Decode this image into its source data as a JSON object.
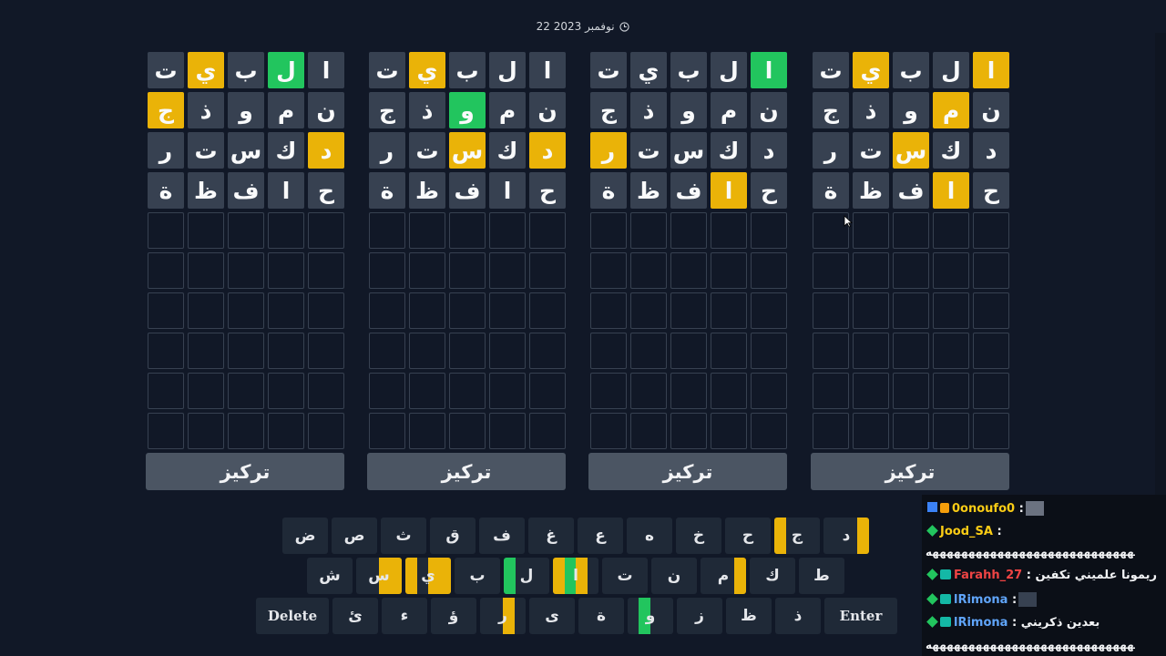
{
  "date": "22 نوفمبر 2023",
  "focus_label": "تركيز",
  "boards": [
    {
      "rows": [
        [
          {
            "c": "ا",
            "s": ""
          },
          {
            "c": "ل",
            "s": "g"
          },
          {
            "c": "ب",
            "s": ""
          },
          {
            "c": "ي",
            "s": "y"
          },
          {
            "c": "ت",
            "s": ""
          }
        ],
        [
          {
            "c": "ن",
            "s": ""
          },
          {
            "c": "م",
            "s": ""
          },
          {
            "c": "و",
            "s": ""
          },
          {
            "c": "ذ",
            "s": ""
          },
          {
            "c": "ج",
            "s": "y"
          }
        ],
        [
          {
            "c": "د",
            "s": "y"
          },
          {
            "c": "ك",
            "s": ""
          },
          {
            "c": "س",
            "s": ""
          },
          {
            "c": "ت",
            "s": ""
          },
          {
            "c": "ر",
            "s": ""
          }
        ],
        [
          {
            "c": "ح",
            "s": ""
          },
          {
            "c": "ا",
            "s": ""
          },
          {
            "c": "ف",
            "s": ""
          },
          {
            "c": "ظ",
            "s": ""
          },
          {
            "c": "ة",
            "s": ""
          }
        ]
      ]
    },
    {
      "rows": [
        [
          {
            "c": "ا",
            "s": ""
          },
          {
            "c": "ل",
            "s": ""
          },
          {
            "c": "ب",
            "s": ""
          },
          {
            "c": "ي",
            "s": "y"
          },
          {
            "c": "ت",
            "s": ""
          }
        ],
        [
          {
            "c": "ن",
            "s": ""
          },
          {
            "c": "م",
            "s": ""
          },
          {
            "c": "و",
            "s": "g"
          },
          {
            "c": "ذ",
            "s": ""
          },
          {
            "c": "ج",
            "s": ""
          }
        ],
        [
          {
            "c": "د",
            "s": "y"
          },
          {
            "c": "ك",
            "s": ""
          },
          {
            "c": "س",
            "s": "y"
          },
          {
            "c": "ت",
            "s": ""
          },
          {
            "c": "ر",
            "s": ""
          }
        ],
        [
          {
            "c": "ح",
            "s": ""
          },
          {
            "c": "ا",
            "s": ""
          },
          {
            "c": "ف",
            "s": ""
          },
          {
            "c": "ظ",
            "s": ""
          },
          {
            "c": "ة",
            "s": ""
          }
        ]
      ]
    },
    {
      "rows": [
        [
          {
            "c": "ا",
            "s": "g"
          },
          {
            "c": "ل",
            "s": ""
          },
          {
            "c": "ب",
            "s": ""
          },
          {
            "c": "ي",
            "s": ""
          },
          {
            "c": "ت",
            "s": ""
          }
        ],
        [
          {
            "c": "ن",
            "s": ""
          },
          {
            "c": "م",
            "s": ""
          },
          {
            "c": "و",
            "s": ""
          },
          {
            "c": "ذ",
            "s": ""
          },
          {
            "c": "ج",
            "s": ""
          }
        ],
        [
          {
            "c": "د",
            "s": ""
          },
          {
            "c": "ك",
            "s": ""
          },
          {
            "c": "س",
            "s": ""
          },
          {
            "c": "ت",
            "s": ""
          },
          {
            "c": "ر",
            "s": "y"
          }
        ],
        [
          {
            "c": "ح",
            "s": ""
          },
          {
            "c": "ا",
            "s": "y"
          },
          {
            "c": "ف",
            "s": ""
          },
          {
            "c": "ظ",
            "s": ""
          },
          {
            "c": "ة",
            "s": ""
          }
        ]
      ]
    },
    {
      "rows": [
        [
          {
            "c": "ا",
            "s": "y"
          },
          {
            "c": "ل",
            "s": ""
          },
          {
            "c": "ب",
            "s": ""
          },
          {
            "c": "ي",
            "s": "y"
          },
          {
            "c": "ت",
            "s": ""
          }
        ],
        [
          {
            "c": "ن",
            "s": ""
          },
          {
            "c": "م",
            "s": "y"
          },
          {
            "c": "و",
            "s": ""
          },
          {
            "c": "ذ",
            "s": ""
          },
          {
            "c": "ج",
            "s": ""
          }
        ],
        [
          {
            "c": "د",
            "s": ""
          },
          {
            "c": "ك",
            "s": ""
          },
          {
            "c": "س",
            "s": "y"
          },
          {
            "c": "ت",
            "s": ""
          },
          {
            "c": "ر",
            "s": ""
          }
        ],
        [
          {
            "c": "ح",
            "s": ""
          },
          {
            "c": "ا",
            "s": "y"
          },
          {
            "c": "ف",
            "s": ""
          },
          {
            "c": "ظ",
            "s": ""
          },
          {
            "c": "ة",
            "s": ""
          }
        ]
      ]
    }
  ],
  "keyboard": {
    "row1": [
      {
        "c": "د",
        "marks": [
          "y",
          "",
          "",
          ""
        ]
      },
      {
        "c": "ج",
        "marks": [
          "",
          "",
          "",
          "y"
        ]
      },
      {
        "c": "ح",
        "marks": [
          "",
          "",
          "",
          ""
        ]
      },
      {
        "c": "خ",
        "marks": [
          "",
          "",
          "",
          ""
        ]
      },
      {
        "c": "ه",
        "marks": [
          "",
          "",
          "",
          ""
        ]
      },
      {
        "c": "ع",
        "marks": [
          "",
          "",
          "",
          ""
        ]
      },
      {
        "c": "غ",
        "marks": [
          "",
          "",
          "",
          ""
        ]
      },
      {
        "c": "ف",
        "marks": [
          "",
          "",
          "",
          ""
        ]
      },
      {
        "c": "ق",
        "marks": [
          "",
          "",
          "",
          ""
        ]
      },
      {
        "c": "ث",
        "marks": [
          "",
          "",
          "",
          ""
        ]
      },
      {
        "c": "ص",
        "marks": [
          "",
          "",
          "",
          ""
        ]
      },
      {
        "c": "ض",
        "marks": [
          "",
          "",
          "",
          ""
        ]
      }
    ],
    "row2": [
      {
        "c": "ط",
        "marks": [
          "",
          "",
          "",
          ""
        ]
      },
      {
        "c": "ك",
        "marks": [
          "",
          "",
          "",
          ""
        ]
      },
      {
        "c": "م",
        "marks": [
          "y",
          "",
          "",
          ""
        ]
      },
      {
        "c": "ن",
        "marks": [
          "",
          "",
          "",
          ""
        ]
      },
      {
        "c": "ت",
        "marks": [
          "",
          "",
          "",
          ""
        ]
      },
      {
        "c": "ا",
        "marks": [
          "",
          "y",
          "g",
          "y"
        ]
      },
      {
        "c": "ل",
        "marks": [
          "",
          "",
          "",
          "g"
        ]
      },
      {
        "c": "ب",
        "marks": [
          "",
          "",
          "",
          ""
        ]
      },
      {
        "c": "ي",
        "marks": [
          "y",
          "y",
          "",
          "y"
        ]
      },
      {
        "c": "س",
        "marks": [
          "y",
          "y",
          "",
          ""
        ]
      },
      {
        "c": "ش",
        "marks": [
          "",
          "",
          "",
          ""
        ]
      }
    ],
    "row3": [
      {
        "c": "ذ",
        "marks": [
          "",
          "",
          "",
          ""
        ]
      },
      {
        "c": "ظ",
        "marks": [
          "",
          "",
          "",
          ""
        ]
      },
      {
        "c": "ز",
        "marks": [
          "",
          "",
          "",
          ""
        ]
      },
      {
        "c": "و",
        "marks": [
          "",
          "",
          "g",
          ""
        ]
      },
      {
        "c": "ة",
        "marks": [
          "",
          "",
          "",
          ""
        ]
      },
      {
        "c": "ى",
        "marks": [
          "",
          "",
          "",
          ""
        ]
      },
      {
        "c": "ر",
        "marks": [
          "",
          "y",
          "",
          ""
        ]
      },
      {
        "c": "ؤ",
        "marks": [
          "",
          "",
          "",
          ""
        ]
      },
      {
        "c": "ء",
        "marks": [
          "",
          "",
          "",
          ""
        ]
      },
      {
        "c": "ئ",
        "marks": [
          "",
          "",
          "",
          ""
        ]
      }
    ],
    "enter_label": "Enter",
    "delete_label": "Delete"
  },
  "chat": [
    {
      "user": "0onoufo0",
      "user_color": "#facc15",
      "text": ":",
      "icons": [
        "arrow-icon",
        "badge-icon"
      ],
      "avatar": true
    },
    {
      "user": "Jood_SA",
      "user_color": "#facc15",
      "text": ":",
      "icons": [
        "diamond-icon"
      ],
      "avatar": false
    },
    {
      "user": "Farahh_27",
      "user_color": "#ef4444",
      "text": ": ريمونا علميني تكفين",
      "icons": [
        "diamond-icon",
        "badge-icon"
      ],
      "avatar": false
    },
    {
      "user": "lRimona",
      "user_color": "#60a5fa",
      "text": ":",
      "icons": [
        "diamond-icon",
        "badge-icon"
      ],
      "avatar": true
    },
    {
      "user": "lRimona",
      "user_color": "#60a5fa",
      "text": ": بعدين ذكريني",
      "icons": [
        "diamond-icon",
        "badge-icon"
      ],
      "avatar": false
    }
  ],
  "chat_spam": "ههههههههههههههههههههههههههههههههههههههه"
}
